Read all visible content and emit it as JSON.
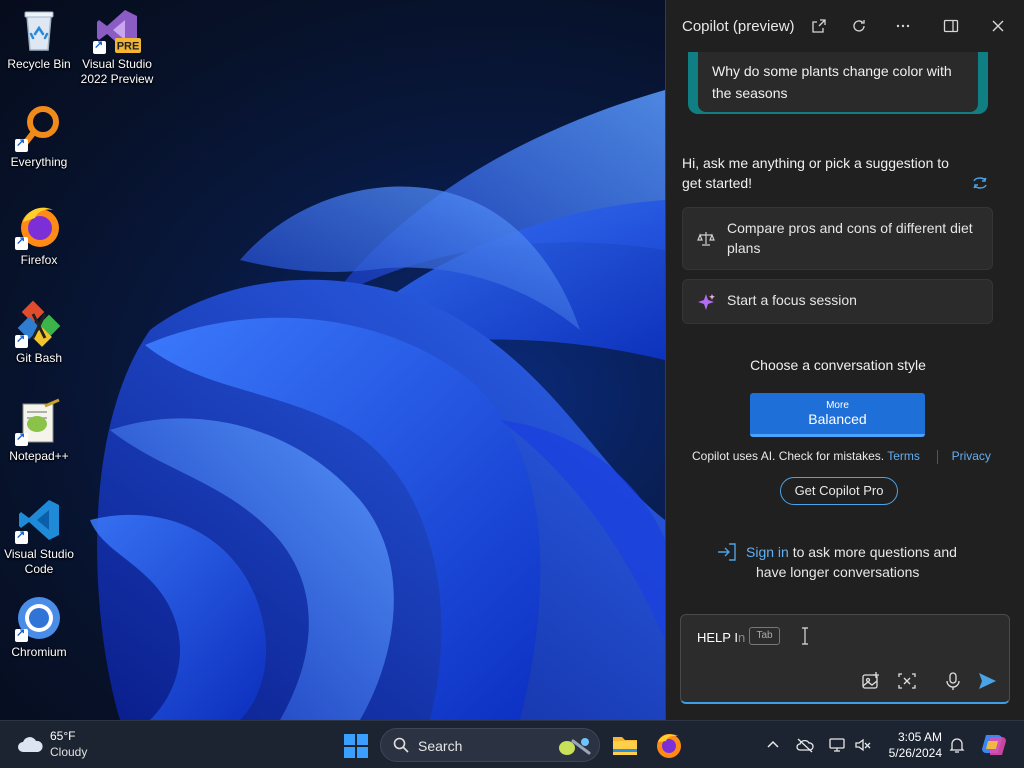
{
  "desktop": {
    "icons": [
      {
        "label": "Recycle Bin",
        "icon": "recycle-bin-icon"
      },
      {
        "label": "Visual Studio 2022 Preview",
        "icon": "visual-studio-preview-icon",
        "badge": "PRE"
      },
      {
        "label": "Everything",
        "icon": "everything-search-icon"
      },
      {
        "label": "Firefox",
        "icon": "firefox-icon"
      },
      {
        "label": "Git Bash",
        "icon": "git-bash-icon"
      },
      {
        "label": "Notepad++",
        "icon": "notepadpp-icon"
      },
      {
        "label": "Visual Studio Code",
        "icon": "vscode-icon"
      },
      {
        "label": "Chromium",
        "icon": "chromium-icon"
      }
    ]
  },
  "copilot": {
    "title": "Copilot (preview)",
    "header_buttons": [
      "open-in-new-icon",
      "refresh-icon",
      "more-icon",
      "split-view-icon",
      "close-icon"
    ],
    "top_suggestion": "Why do some plants change color with the seasons",
    "greeting": "Hi, ask me anything or pick a suggestion to get started!",
    "suggestions": [
      {
        "label": "Compare pros and cons of different diet plans",
        "icon": "scales-icon"
      },
      {
        "label": "Start a focus session",
        "icon": "sparkle-icon"
      }
    ],
    "style_title": "Choose a conversation style",
    "style_more": "More",
    "style_name": "Balanced",
    "disclaimer": "Copilot uses AI. Check for mistakes.",
    "terms": "Terms",
    "privacy": "Privacy",
    "pro_button": "Get Copilot Pro",
    "signin_link": "Sign in",
    "signin_rest": "to ask more questions and",
    "signin_line2": "have longer conversations",
    "composer": {
      "typed": "HELP I",
      "ghost": "n",
      "tab_hint": "Tab"
    }
  },
  "taskbar": {
    "weather_temp": "65°F",
    "weather_cond": "Cloudy",
    "search_label": "Search",
    "time": "3:05 AM",
    "date": "5/26/2024",
    "accent": "#1f6fd8"
  }
}
